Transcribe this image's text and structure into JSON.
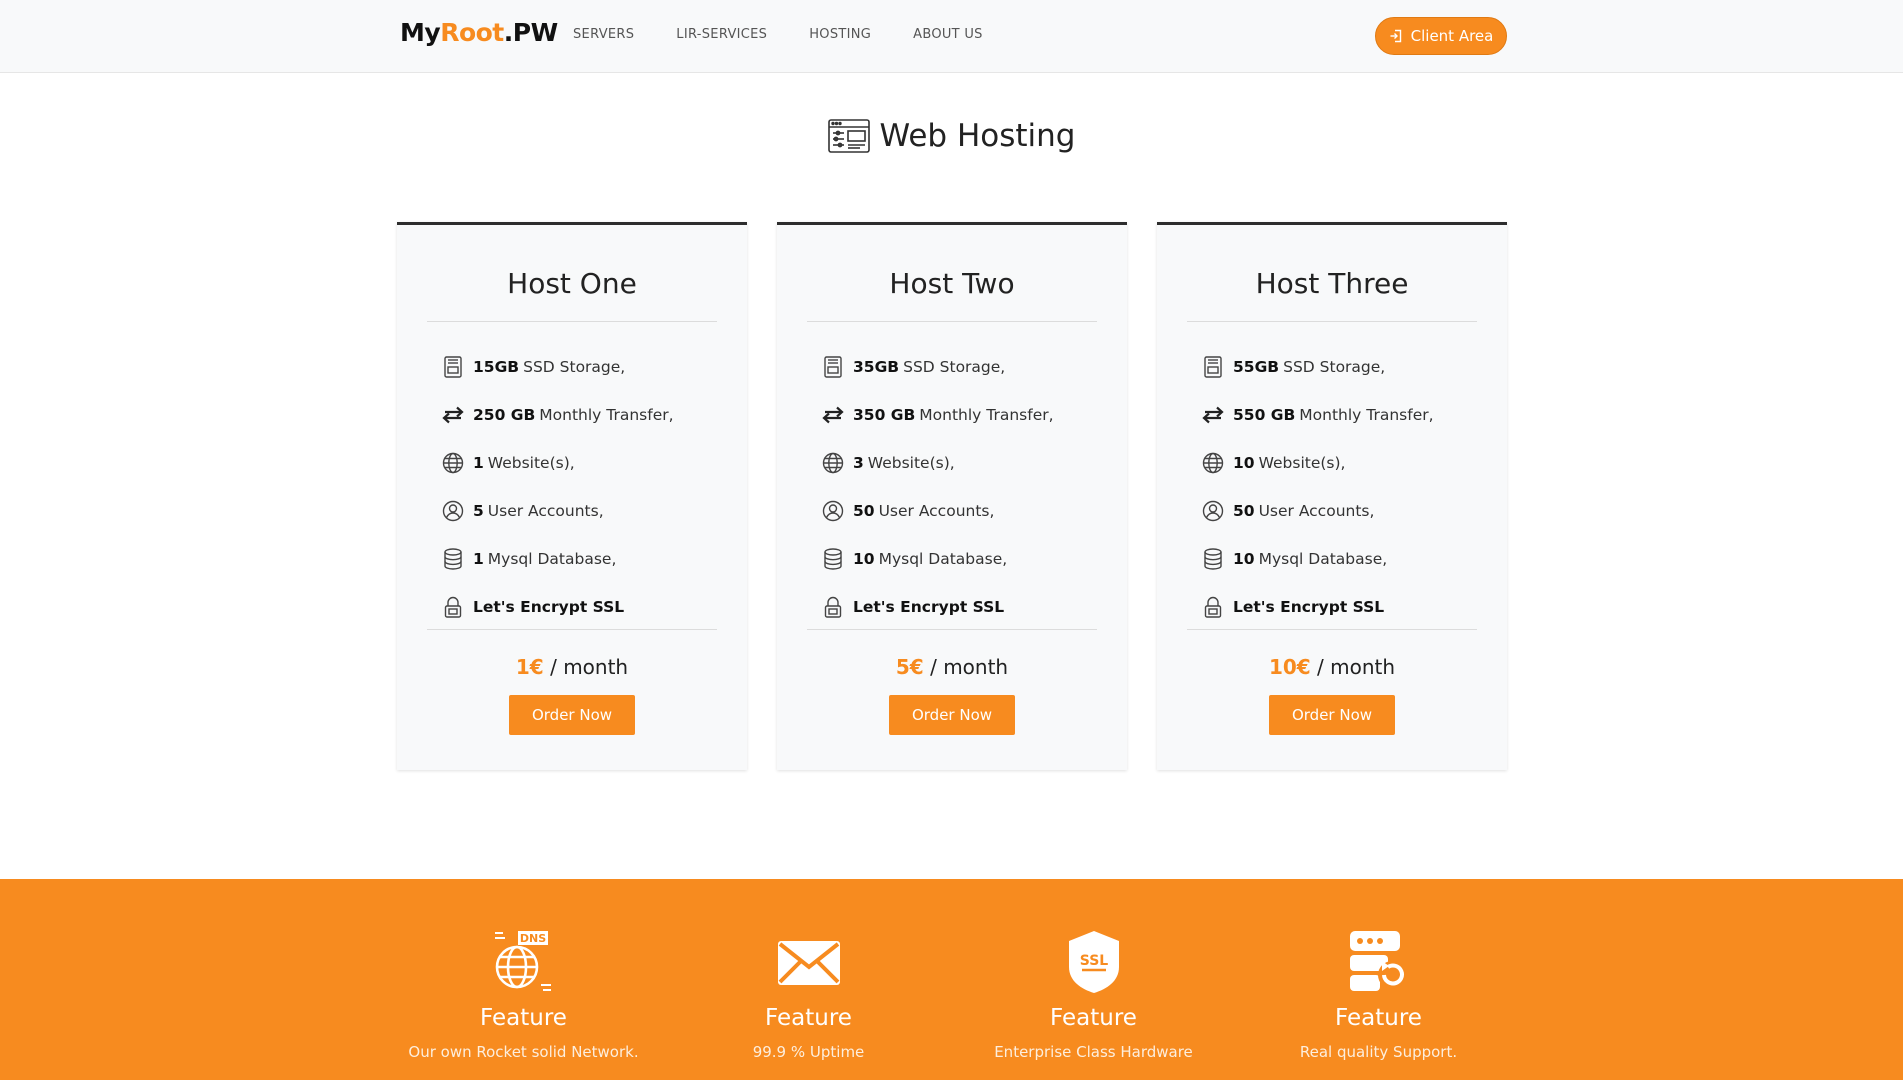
{
  "header": {
    "logo": {
      "part1": "My",
      "part2": "Root",
      "part3": ".PW"
    },
    "nav": [
      "SERVERS",
      "LIR-SERVICES",
      "HOSTING",
      "ABOUT US"
    ],
    "client_area": "Client Area"
  },
  "main": {
    "title": "Web Hosting",
    "plans": [
      {
        "name": "Host One",
        "features": [
          {
            "icon": "ssd-icon",
            "bold": "15GB",
            "text": "SSD Storage,"
          },
          {
            "icon": "transfer-icon",
            "bold": "250 GB",
            "text": "Monthly Transfer,"
          },
          {
            "icon": "globe-icon",
            "bold": "1",
            "text": "Website(s),"
          },
          {
            "icon": "user-icon",
            "bold": "5",
            "text": "User Accounts,"
          },
          {
            "icon": "database-icon",
            "bold": "1",
            "text": "Mysql Database,"
          },
          {
            "icon": "lock-icon",
            "bold": "Let's Encrypt SSL",
            "text": ""
          }
        ],
        "price": "1€",
        "period": "/ month",
        "order": "Order Now"
      },
      {
        "name": "Host Two",
        "features": [
          {
            "icon": "ssd-icon",
            "bold": "35GB",
            "text": "SSD Storage,"
          },
          {
            "icon": "transfer-icon",
            "bold": "350 GB",
            "text": "Monthly Transfer,"
          },
          {
            "icon": "globe-icon",
            "bold": "3",
            "text": "Website(s),"
          },
          {
            "icon": "user-icon",
            "bold": "50",
            "text": "User Accounts,"
          },
          {
            "icon": "database-icon",
            "bold": "10",
            "text": "Mysql Database,"
          },
          {
            "icon": "lock-icon",
            "bold": "Let's Encrypt SSL",
            "text": ""
          }
        ],
        "price": "5€",
        "period": "/ month",
        "order": "Order Now"
      },
      {
        "name": "Host Three",
        "features": [
          {
            "icon": "ssd-icon",
            "bold": "55GB",
            "text": "SSD Storage,"
          },
          {
            "icon": "transfer-icon",
            "bold": "550 GB",
            "text": "Monthly Transfer,"
          },
          {
            "icon": "globe-icon",
            "bold": "10",
            "text": "Website(s),"
          },
          {
            "icon": "user-icon",
            "bold": "50",
            "text": "User Accounts,"
          },
          {
            "icon": "database-icon",
            "bold": "10",
            "text": "Mysql Database,"
          },
          {
            "icon": "lock-icon",
            "bold": "Let's Encrypt SSL",
            "text": ""
          }
        ],
        "price": "10€",
        "period": "/ month",
        "order": "Order Now"
      }
    ]
  },
  "features": [
    {
      "icon": "dns-globe-icon",
      "badge": "DNS",
      "title": "Feature",
      "desc": "Our own Rocket solid Network."
    },
    {
      "icon": "envelope-icon",
      "badge": "",
      "title": "Feature",
      "desc": "99.9 % Uptime"
    },
    {
      "icon": "ssl-shield-icon",
      "badge": "SSL",
      "title": "Feature",
      "desc": "Enterprise Class Hardware"
    },
    {
      "icon": "server-restore-icon",
      "badge": "",
      "title": "Feature",
      "desc": "Real quality Support."
    }
  ],
  "colors": {
    "accent": "#f78b1f",
    "dark": "#2d2d2d",
    "card_bg": "#f8f9fa"
  }
}
